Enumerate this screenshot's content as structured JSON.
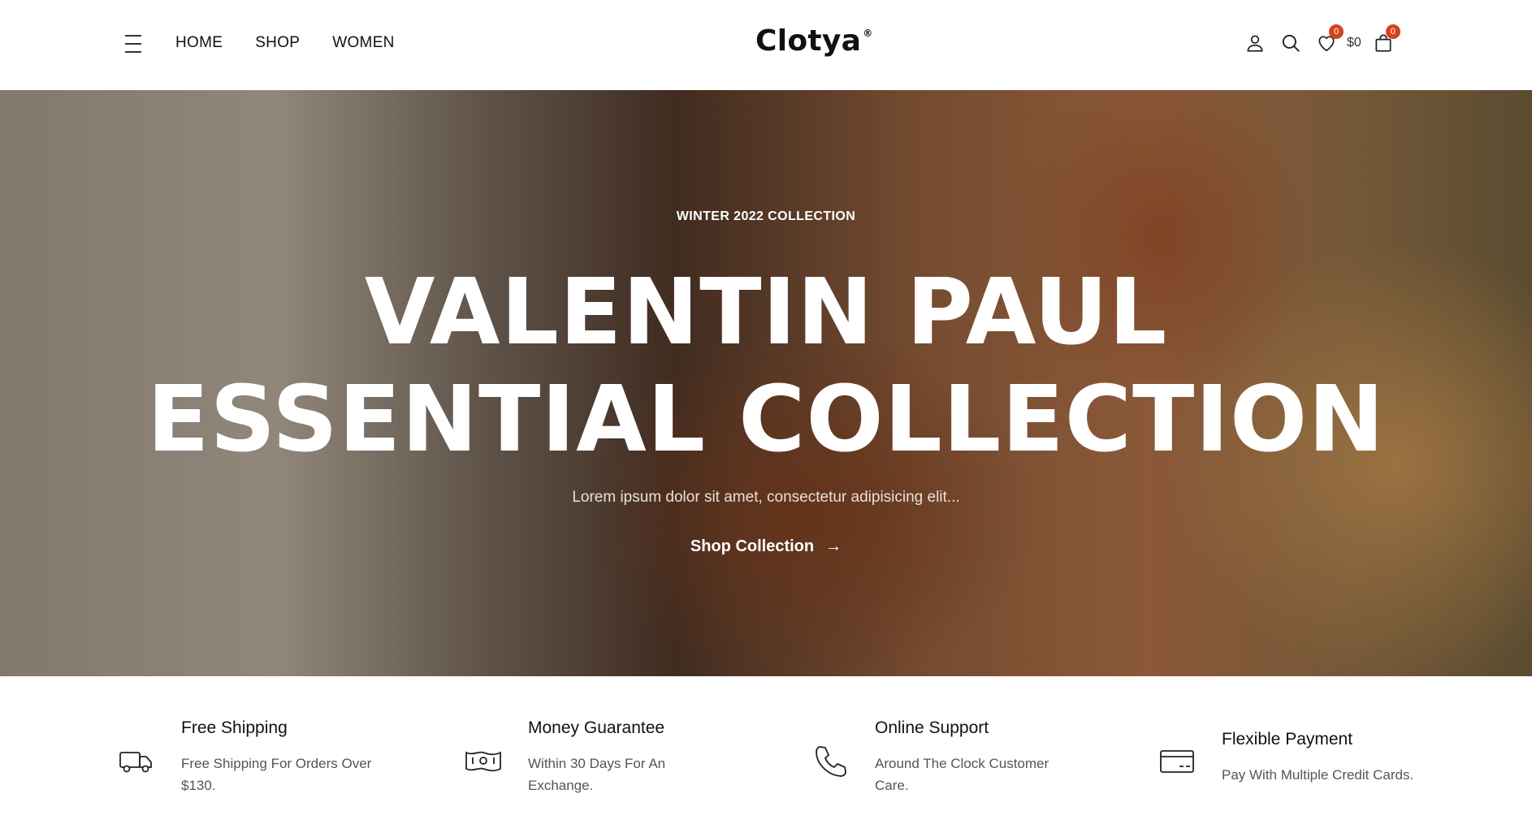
{
  "header": {
    "nav": [
      "HOME",
      "SHOP",
      "WOMEN"
    ],
    "logo": "Clotya",
    "logo_mark": "®",
    "wishlist_count": "0",
    "cart_total": "$0",
    "cart_count": "0"
  },
  "hero": {
    "eyebrow": "WINTER 2022 COLLECTION",
    "title_line1": "VALENTIN PAUL",
    "title_line2": "ESSENTIAL COLLECTION",
    "subtitle": "Lorem ipsum dolor sit amet, consectetur adipisicing elit...",
    "cta": "Shop Collection",
    "cta_arrow": "→"
  },
  "features": [
    {
      "title": "Free Shipping",
      "desc": "Free Shipping For Orders Over $130.",
      "icon": "truck-icon"
    },
    {
      "title": "Money Guarantee",
      "desc": "Within 30 Days For An Exchange.",
      "icon": "money-icon"
    },
    {
      "title": "Online Support",
      "desc": "Around The Clock Customer Care.",
      "icon": "phone-icon"
    },
    {
      "title": "Flexible Payment",
      "desc": "Pay With Multiple Credit Cards.",
      "icon": "credit-card-icon"
    }
  ],
  "colors": {
    "badge": "#d4431f",
    "text": "#111111"
  }
}
